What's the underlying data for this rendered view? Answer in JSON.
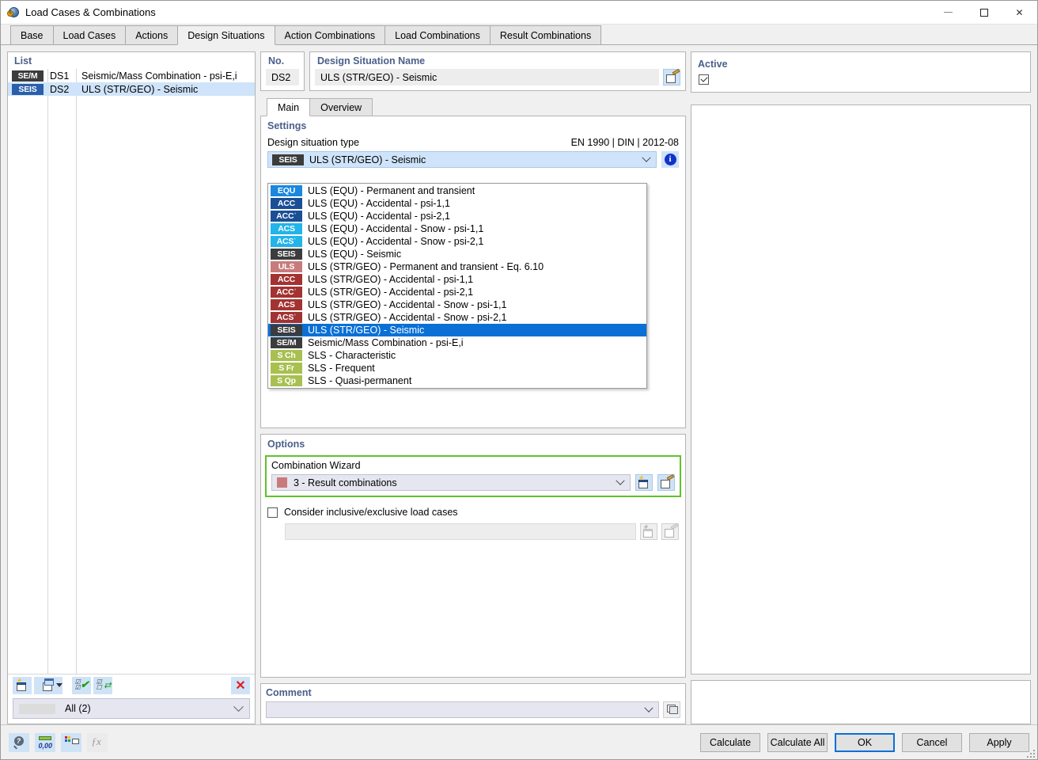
{
  "window": {
    "title": "Load Cases & Combinations",
    "app_icon": "load-cases-icon",
    "minimize": "–",
    "maximize": "□",
    "close": "✕"
  },
  "tabs": [
    {
      "label": "Base",
      "active": false
    },
    {
      "label": "Load Cases",
      "active": false
    },
    {
      "label": "Actions",
      "active": false
    },
    {
      "label": "Design Situations",
      "active": true
    },
    {
      "label": "Action Combinations",
      "active": false
    },
    {
      "label": "Load Combinations",
      "active": false
    },
    {
      "label": "Result Combinations",
      "active": false
    }
  ],
  "list_panel": {
    "label": "List",
    "rows": [
      {
        "badge": "SE/M",
        "badge_color": "#3c3c3c",
        "no": "DS1",
        "name": "Seismic/Mass Combination - psi-E,i",
        "selected": false
      },
      {
        "badge": "SEIS",
        "badge_color": "#2b5faa",
        "no": "DS2",
        "name": "ULS (STR/GEO) - Seismic",
        "selected": true
      }
    ],
    "toolbar": [
      {
        "name": "new-button",
        "icon": "new-page-icon"
      },
      {
        "name": "copy-button",
        "icon": "copy-page-dropdown-icon"
      },
      {
        "name": "select-all-button",
        "icon": "check-all-icon"
      },
      {
        "name": "invert-selection-button",
        "icon": "toggle-selection-icon"
      },
      {
        "name": "delete-button",
        "icon": "red-x-icon",
        "glyph": "✕"
      }
    ],
    "filter": {
      "text": "All (2)"
    }
  },
  "detail": {
    "no_label": "No.",
    "no_value": "DS2",
    "name_label": "Design Situation Name",
    "name_value": "ULS (STR/GEO) - Seismic",
    "edit_icon": "edit-name-icon"
  },
  "active_panel": {
    "label": "Active",
    "checked": true
  },
  "subtabs": [
    {
      "label": "Main",
      "active": true
    },
    {
      "label": "Overview",
      "active": false
    }
  ],
  "settings": {
    "section_label": "Settings",
    "field_label": "Design situation type",
    "standard": "EN 1990 | DIN | 2012-08",
    "selected_badge": "SEIS",
    "selected_badge_color": "#3c3c3c",
    "selected_value": "ULS (STR/GEO) - Seismic",
    "info_icon": "info-icon",
    "info_glyph": "i",
    "dropdown_options": [
      {
        "badge": "EQU",
        "badge_color": "#1a87e0",
        "label": "ULS (EQU) - Permanent and transient",
        "selected": false
      },
      {
        "badge": "ACC",
        "badge_color": "#1a4f96",
        "label": "ULS (EQU) - Accidental - psi-1,1",
        "selected": false
      },
      {
        "badge": "ACCˈ",
        "badge_color": "#1a4f96",
        "label": "ULS (EQU) - Accidental - psi-2,1",
        "selected": false
      },
      {
        "badge": "ACS",
        "badge_color": "#22b4ea",
        "label": "ULS (EQU) - Accidental - Snow - psi-1,1",
        "selected": false
      },
      {
        "badge": "ACSˈ",
        "badge_color": "#22b4ea",
        "label": "ULS (EQU) - Accidental - Snow - psi-2,1",
        "selected": false
      },
      {
        "badge": "SEIS",
        "badge_color": "#3c3c3c",
        "label": "ULS (EQU) - Seismic",
        "selected": false
      },
      {
        "badge": "ULS",
        "badge_color": "#c97b7b",
        "label": "ULS (STR/GEO) - Permanent and transient - Eq. 6.10",
        "selected": false
      },
      {
        "badge": "ACC",
        "badge_color": "#a33232",
        "label": "ULS (STR/GEO) - Accidental - psi-1,1",
        "selected": false
      },
      {
        "badge": "ACCˈ",
        "badge_color": "#a33232",
        "label": "ULS (STR/GEO) - Accidental - psi-2,1",
        "selected": false
      },
      {
        "badge": "ACS",
        "badge_color": "#a33232",
        "label": "ULS (STR/GEO) - Accidental - Snow - psi-1,1",
        "selected": false
      },
      {
        "badge": "ACSˈ",
        "badge_color": "#a33232",
        "label": "ULS (STR/GEO) - Accidental - Snow - psi-2,1",
        "selected": false
      },
      {
        "badge": "SEIS",
        "badge_color": "#3c3c3c",
        "label": "ULS (STR/GEO) - Seismic",
        "selected": true
      },
      {
        "badge": "SE/M",
        "badge_color": "#3c3c3c",
        "label": "Seismic/Mass Combination - psi-E,i",
        "selected": false
      },
      {
        "badge": "S Ch",
        "badge_color": "#a8c050",
        "label": "SLS - Characteristic",
        "selected": false
      },
      {
        "badge": "S Fr",
        "badge_color": "#a8c050",
        "label": "SLS - Frequent",
        "selected": false
      },
      {
        "badge": "S Qp",
        "badge_color": "#a8c050",
        "label": "SLS - Quasi-permanent",
        "selected": false
      }
    ]
  },
  "options": {
    "section_label": "Options",
    "wizard_label": "Combination Wizard",
    "wizard_value": "3 - Result combinations",
    "wizard_swatch_color": "#c97b7b",
    "wizard_new_icon": "new-wizard-icon",
    "wizard_edit_icon": "edit-wizard-icon",
    "highlight_color": "#62c12a",
    "checkbox_label": "Consider inclusive/exclusive load cases",
    "checkbox_checked": false,
    "disabled_new_icon": "new-disabled-icon",
    "disabled_edit_icon": "edit-disabled-icon"
  },
  "comment": {
    "label": "Comment",
    "value": "",
    "copy_icon": "copy-comment-icon"
  },
  "statusbar": {
    "icons": [
      {
        "name": "help-search-icon",
        "disabled": false
      },
      {
        "name": "units-icon",
        "disabled": false
      },
      {
        "name": "display-properties-icon",
        "disabled": false
      },
      {
        "name": "formula-icon",
        "disabled": true
      }
    ],
    "buttons": [
      {
        "label": "Calculate",
        "default": false
      },
      {
        "label": "Calculate All",
        "default": false
      },
      {
        "label": "OK",
        "default": true
      },
      {
        "label": "Cancel",
        "default": false
      },
      {
        "label": "Apply",
        "default": false
      }
    ]
  }
}
